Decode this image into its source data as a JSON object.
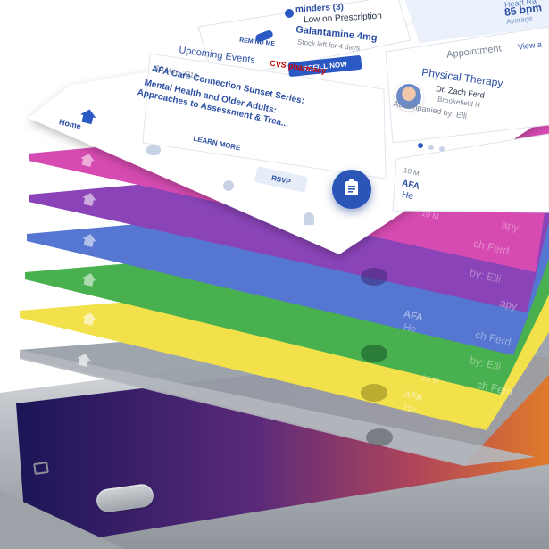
{
  "colors": {
    "layers": [
      "#9aa0a8",
      "#f2e14a",
      "#48b04e",
      "#5577d1",
      "#8a44b8",
      "#d64bb1"
    ],
    "primary_blue": "#2b59c3",
    "cvs_red": "#cc0000"
  },
  "nav": {
    "home_label": "Home"
  },
  "header": {
    "reminders_label": "minders (3)",
    "heart_rate_label": "Heart Ra",
    "heart_rate_value": "85 bpm",
    "heart_rate_caption": "Average"
  },
  "prescription": {
    "status_text": "Low on Prescription",
    "drug_name": "Galantamine 4mg",
    "stock_text": "Stock left for 4 days",
    "remind_label": "REMIND ME",
    "refill_label": "REFILL NOW",
    "pharmacy_name": "CVS pharmacy"
  },
  "events": {
    "section_title": "Upcoming Events",
    "date": "10 May, 2019",
    "title_line1": "AFA Care Connection Sunset Series:",
    "title_line2": "Mental Health and Older Adults:",
    "title_line3": "Approaches to Assessment & Trea...",
    "learn_more_label": "LEARN MORE",
    "rsvp_label": "RSVP"
  },
  "appointment": {
    "section_title": "Appointment",
    "view_all_label": "View a",
    "type": "Physical Therapy",
    "doctor": "Dr. Zach Ferd",
    "location": "Brookefield H",
    "accompanied": "Accompanied by: Elli"
  },
  "background_layers": {
    "partial_text_1": "apy",
    "partial_text_2": "ch Ferd",
    "partial_text_3": "by: Elli",
    "partial_text_4": "AFA",
    "partial_text_5": "He",
    "partial_text_6": "10 M"
  }
}
